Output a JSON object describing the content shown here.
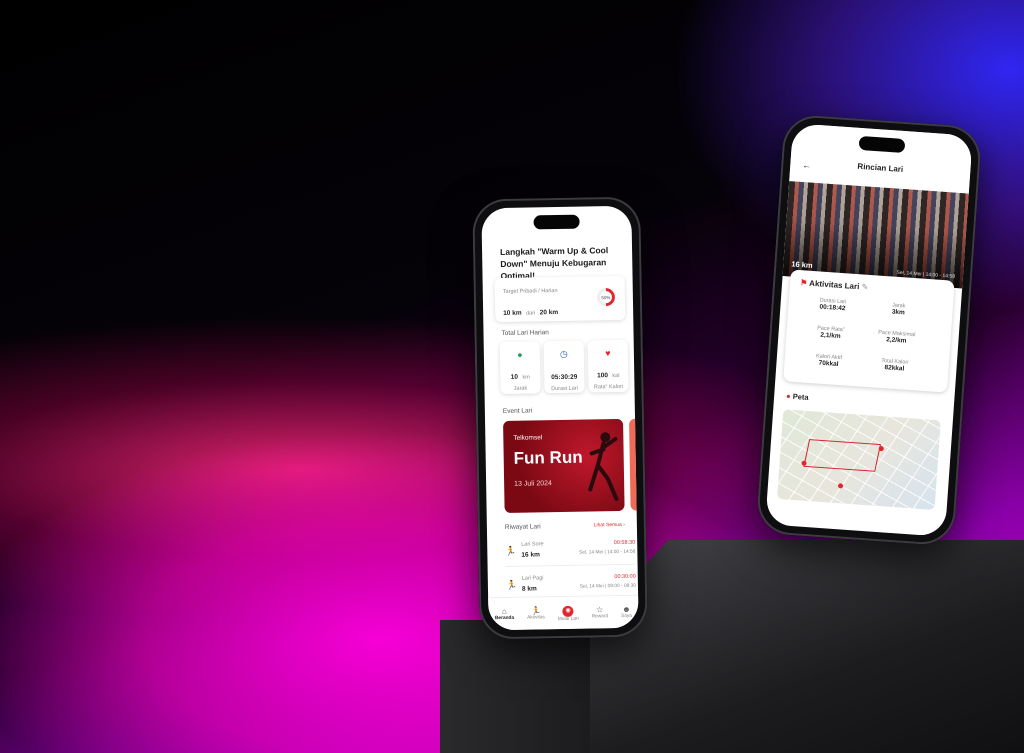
{
  "phone1": {
    "headline": "Langkah \"Warm Up & Cool Down\" Menuju Kebugaran Optimal!",
    "target": {
      "label": "Target Pribadi / Harian",
      "current": "10 km",
      "of": "dari",
      "goal": "20 km",
      "percent_label": "50%"
    },
    "total_section": "Total Lari Harian",
    "stats": [
      {
        "icon": "location-pin-icon",
        "value": "10",
        "unit": "km",
        "label": "Jarak"
      },
      {
        "icon": "clock-icon",
        "value": "05:30:29",
        "unit": "",
        "label": "Durasi Lari"
      },
      {
        "icon": "heart-rate-icon",
        "value": "100",
        "unit": "kal",
        "label": "Rata\" Kalori"
      }
    ],
    "event_section": "Event Lari",
    "event": {
      "brand": "Telkomsel",
      "title": "Fun Run",
      "date": "13 Juli 2024"
    },
    "history_section": "Riwayat Lari",
    "see_all": "Lihat Semua",
    "history": [
      {
        "name": "Lari Sore",
        "distance": "16 km",
        "duration": "00:58:30",
        "date": "Sel, 14 Mei | 14:00 - 14:58"
      },
      {
        "name": "Lari Pagi",
        "distance": "8 km",
        "duration": "00:30:00",
        "date": "Sel, 14 Mei | 08:00 - 08:30"
      }
    ],
    "nav": [
      "Beranda",
      "Aktivitas",
      "Mulai Lari",
      "Reward",
      "Saya"
    ]
  },
  "phone2": {
    "title": "Rincian Lari",
    "photo_distance": "16 km",
    "photo_date": "Sel, 14 Mei | 14:00 - 14:58",
    "activity_title": "Aktivitas Lari",
    "metrics": [
      {
        "label": "Durasi Lari",
        "value": "00:18:42"
      },
      {
        "label": "Jarak",
        "value": "3km"
      },
      {
        "label": "Pace Rata\"",
        "value": "2,1/km"
      },
      {
        "label": "Pace Maksimal",
        "value": "2,2/km"
      },
      {
        "label": "Kalori Aktif",
        "value": "70kkal"
      },
      {
        "label": "Total Kalori",
        "value": "82kkal"
      }
    ],
    "map_title": "Peta"
  },
  "colors": {
    "accent": "#e3262e",
    "banner": "#9b0f1c"
  }
}
